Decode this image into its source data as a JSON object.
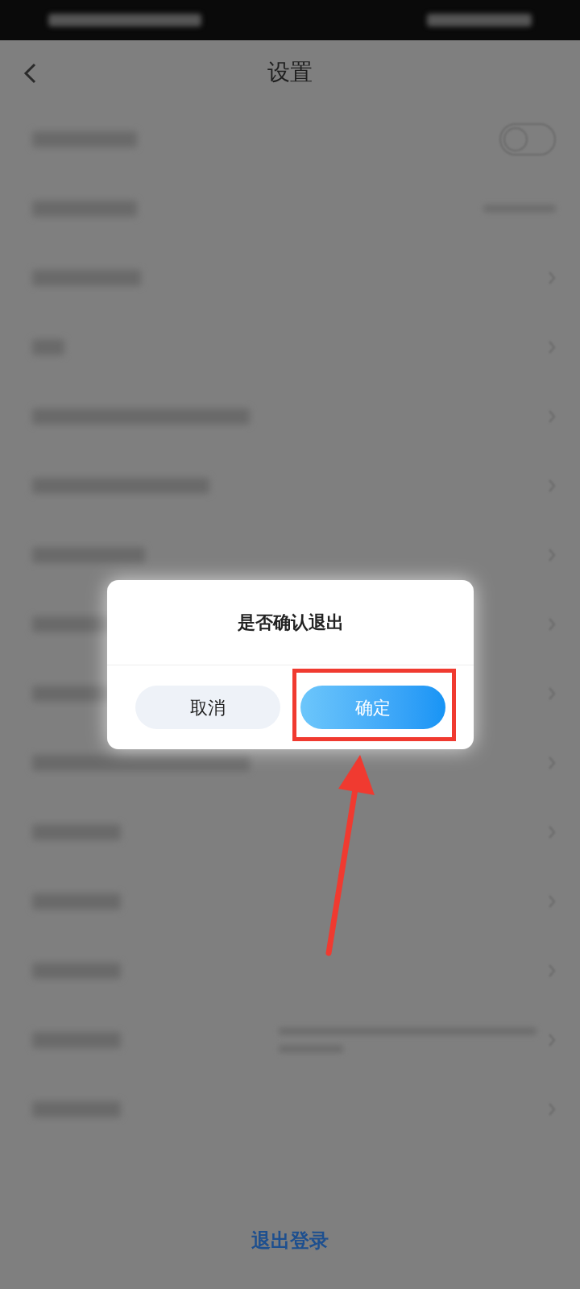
{
  "header": {
    "title": "设置"
  },
  "rows": [
    {
      "kind": "toggle",
      "on": false
    },
    {
      "kind": "value"
    },
    {
      "kind": "link"
    },
    {
      "kind": "link"
    },
    {
      "kind": "link"
    },
    {
      "kind": "link"
    },
    {
      "kind": "link"
    },
    {
      "kind": "link"
    },
    {
      "kind": "link"
    },
    {
      "kind": "link"
    },
    {
      "kind": "link"
    },
    {
      "kind": "link"
    },
    {
      "kind": "link"
    },
    {
      "kind": "detail"
    },
    {
      "kind": "link"
    }
  ],
  "logout": "退出登录",
  "dialog": {
    "title": "是否确认退出",
    "buttons": [
      {
        "label": "取消",
        "kind": "secondary"
      },
      {
        "label": "确定",
        "kind": "primary"
      }
    ]
  }
}
